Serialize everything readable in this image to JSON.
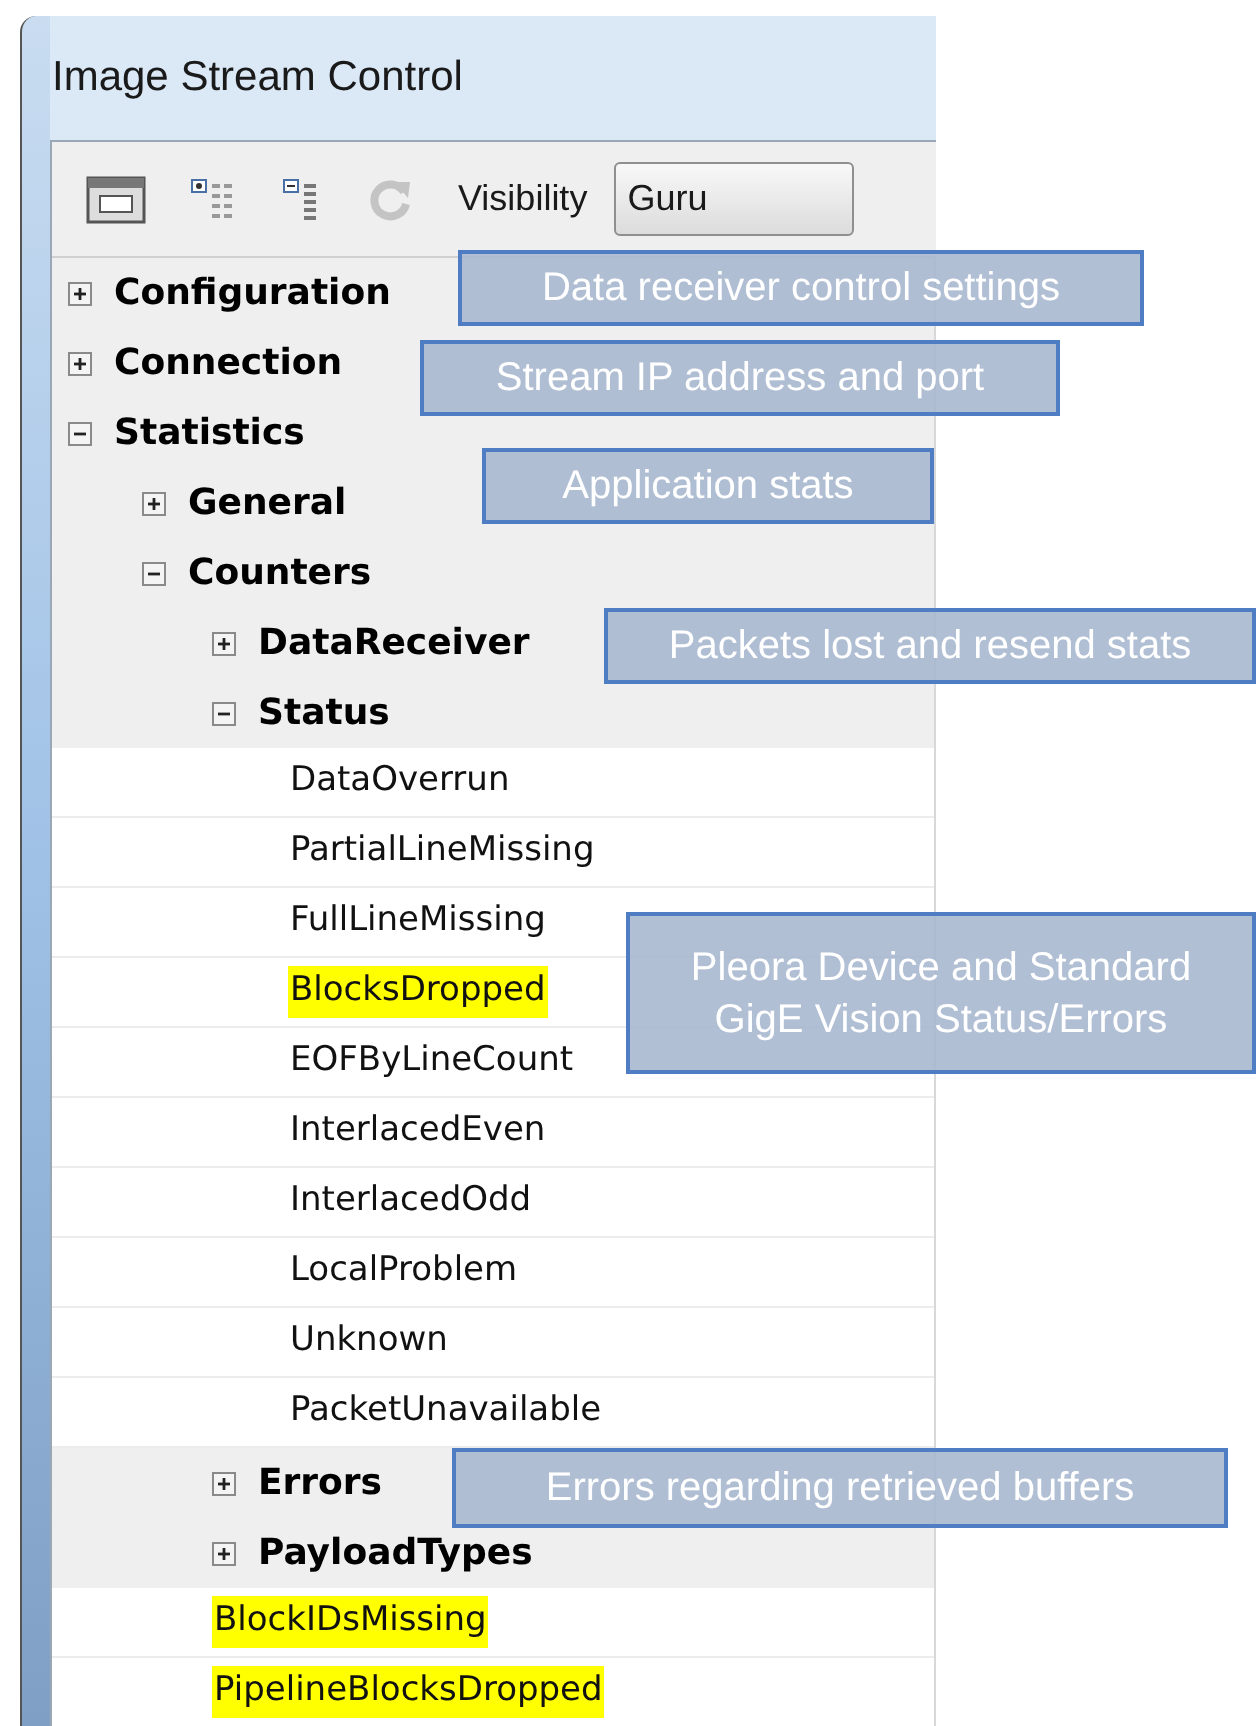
{
  "window": {
    "title": "Image Stream Control"
  },
  "toolbar": {
    "visibility_label": "Visibility",
    "visibility_value": "Guru"
  },
  "tree": [
    {
      "kind": "group",
      "label": "Configuration",
      "expanded": false
    },
    {
      "kind": "group",
      "label": "Connection",
      "expanded": false
    },
    {
      "kind": "group",
      "label": "Statistics",
      "expanded": true,
      "children": [
        {
          "kind": "group",
          "label": "General",
          "expanded": false
        },
        {
          "kind": "group",
          "label": "Counters",
          "expanded": true,
          "children": [
            {
              "kind": "group",
              "label": "DataReceiver",
              "expanded": false
            },
            {
              "kind": "group",
              "label": "Status",
              "expanded": true,
              "children": [
                {
                  "kind": "leaf",
                  "label": "DataOverrun",
                  "highlighted": false
                },
                {
                  "kind": "leaf",
                  "label": "PartialLineMissing",
                  "highlighted": false
                },
                {
                  "kind": "leaf",
                  "label": "FullLineMissing",
                  "highlighted": false
                },
                {
                  "kind": "leaf",
                  "label": "BlocksDropped",
                  "highlighted": true
                },
                {
                  "kind": "leaf",
                  "label": "EOFByLineCount",
                  "highlighted": false
                },
                {
                  "kind": "leaf",
                  "label": "InterlacedEven",
                  "highlighted": false
                },
                {
                  "kind": "leaf",
                  "label": "InterlacedOdd",
                  "highlighted": false
                },
                {
                  "kind": "leaf",
                  "label": "LocalProblem",
                  "highlighted": false
                },
                {
                  "kind": "leaf",
                  "label": "Unknown",
                  "highlighted": false
                },
                {
                  "kind": "leaf",
                  "label": "PacketUnavailable",
                  "highlighted": false
                }
              ]
            },
            {
              "kind": "group",
              "label": "Errors",
              "expanded": false
            },
            {
              "kind": "group",
              "label": "PayloadTypes",
              "expanded": false
            },
            {
              "kind": "leaf",
              "label": "BlockIDsMissing",
              "highlighted": true
            },
            {
              "kind": "leaf",
              "label": "PipelineBlocksDropped",
              "highlighted": true
            }
          ]
        }
      ]
    }
  ],
  "callouts": [
    {
      "text": "Data receiver control settings"
    },
    {
      "text": "Stream IP address and port"
    },
    {
      "text": "Application  stats"
    },
    {
      "text": "Packets lost and resend stats"
    },
    {
      "text": "Pleora Device and Standard\nGigE Vision Status/Errors"
    },
    {
      "text": "Errors regarding retrieved buffers"
    }
  ]
}
